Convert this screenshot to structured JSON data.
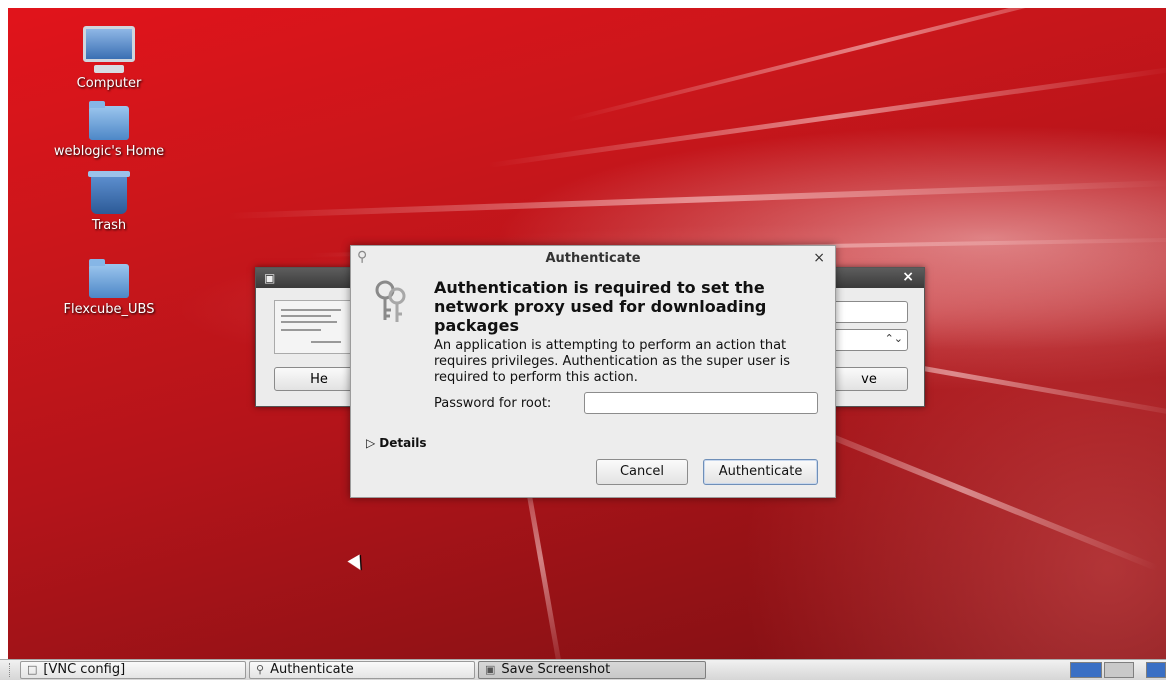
{
  "desktop": {
    "icons": [
      {
        "label": "Computer",
        "icon": "computer-icon"
      },
      {
        "label": "weblogic's Home",
        "icon": "home-folder-icon"
      },
      {
        "label": "Trash",
        "icon": "trash-icon"
      },
      {
        "label": "Flexcube_UBS",
        "icon": "folder-icon"
      }
    ]
  },
  "background_window": {
    "title_icon": "camera-icon",
    "close": "×",
    "help_label": "He",
    "save_label": "ve",
    "spinner": "⌃⌄"
  },
  "dialog": {
    "title": "Authenticate",
    "close": "×",
    "heading": "Authentication is required to set the network proxy used for downloading packages",
    "description": "An application is attempting to perform an action that requires privileges. Authentication as the super user is required to perform this action.",
    "password_label": "Password for root:",
    "password_value": "",
    "details_label": "Details",
    "cancel_label": "Cancel",
    "authenticate_label": "Authenticate"
  },
  "taskbar": {
    "tasks": [
      {
        "label": "[VNC config]",
        "icon": "window-icon"
      },
      {
        "label": "Authenticate",
        "icon": "key-icon"
      },
      {
        "label": "Save Screenshot",
        "icon": "camera-icon"
      }
    ]
  },
  "colors": {
    "wallpaper_primary": "#c9161b",
    "workspace_active": "#3a6fc4"
  }
}
